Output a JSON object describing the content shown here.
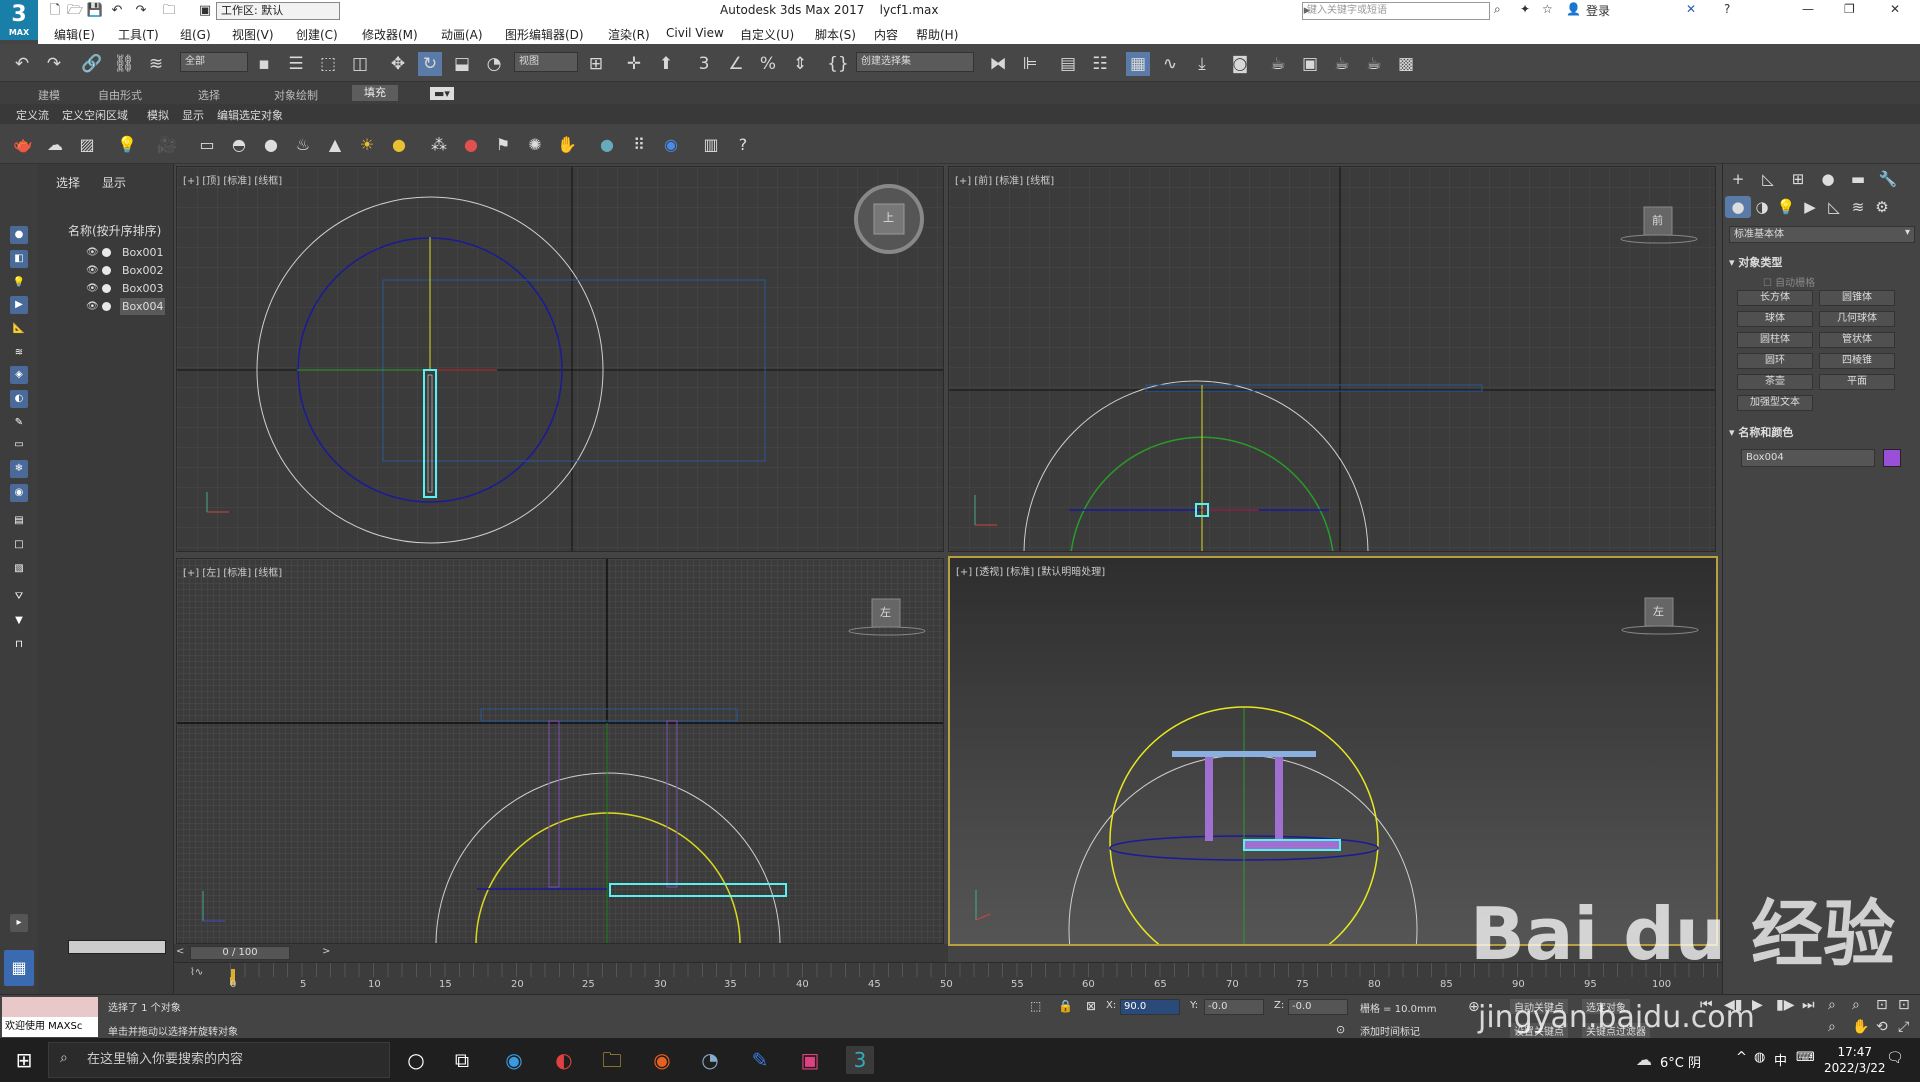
{
  "app": {
    "logo_text": "3",
    "logo_sub": "MAX",
    "workspace_label": "工作区: 默认",
    "title": "Autodesk 3ds Max 2017",
    "filename": "lycf1.max",
    "search_placeholder": "键入关键字或短语",
    "login": "登录"
  },
  "menu": [
    "编辑(E)",
    "工具(T)",
    "组(G)",
    "视图(V)",
    "创建(C)",
    "修改器(M)",
    "动画(A)",
    "图形编辑器(D)",
    "渲染(R)",
    "Civil View",
    "自定义(U)",
    "脚本(S)",
    "内容",
    "帮助(H)"
  ],
  "toolbar": {
    "filter": "全部",
    "ref_coord": "视图",
    "selection_set": "创建选择集"
  },
  "ribbon": {
    "tabs": [
      "建模",
      "自由形式",
      "选择",
      "对象绘制",
      "填充"
    ],
    "active_tab": "填充",
    "row2": [
      "定义流",
      "定义空闲区域",
      "模拟",
      "显示",
      "编辑选定对象"
    ]
  },
  "explorer": {
    "tab_select": "选择",
    "tab_display": "显示",
    "column_header": "名称(按升序排序)",
    "items": [
      "Box001",
      "Box002",
      "Box003",
      "Box004"
    ],
    "selected": "Box004"
  },
  "viewports": {
    "top": "[+] [顶] [标准] [线框]",
    "front": "[+] [前] [标准] [线框]",
    "left": "[+] [左] [标准] [线框]",
    "persp": "[+] [透视] [标准] [默认明暗处理]",
    "viewcube_top": "上",
    "viewcube_front": "前",
    "viewcube_left": "左",
    "viewcube_persp": "左"
  },
  "command_panel": {
    "primitive_type": "标准基本体",
    "section_object_type": "对象类型",
    "autogrid": "自动栅格",
    "buttons": [
      "长方体",
      "圆锥体",
      "球体",
      "几何球体",
      "圆柱体",
      "管状体",
      "圆环",
      "四棱锥",
      "茶壶",
      "平面",
      "加强型文本"
    ],
    "section_name_color": "名称和颜色",
    "object_name": "Box004",
    "object_color": "#9a4fd8"
  },
  "timeline": {
    "frame_display": "0 / 100",
    "ticks": [
      "0",
      "5",
      "10",
      "15",
      "20",
      "25",
      "30",
      "35",
      "40",
      "45",
      "50",
      "55",
      "60",
      "65",
      "70",
      "75",
      "80",
      "85",
      "90",
      "95",
      "100"
    ]
  },
  "status": {
    "maxscript": "欢迎使用 MAXSc",
    "selected_info": "选择了 1 个对象",
    "prompt": "单击并拖动以选择并旋转对象",
    "x_label": "X:",
    "x_value": "90.0",
    "y_label": "Y:",
    "y_value": "-0.0",
    "z_label": "Z:",
    "z_value": "-0.0",
    "grid": "栅格 = 10.0mm",
    "add_time_tag": "添加时间标记",
    "auto_key": "自动关键点",
    "selected_object": "选定对象",
    "set_key": "设置关键点",
    "key_filter": "关键点过滤器"
  },
  "taskbar": {
    "search": "在这里输入你要搜索的内容",
    "weather": "6°C 阴",
    "ime": "中",
    "time": "17:47",
    "date": "2022/3/22"
  },
  "watermark": {
    "text1": "Bai du 经验",
    "text2": "jingyan.baidu.com"
  }
}
